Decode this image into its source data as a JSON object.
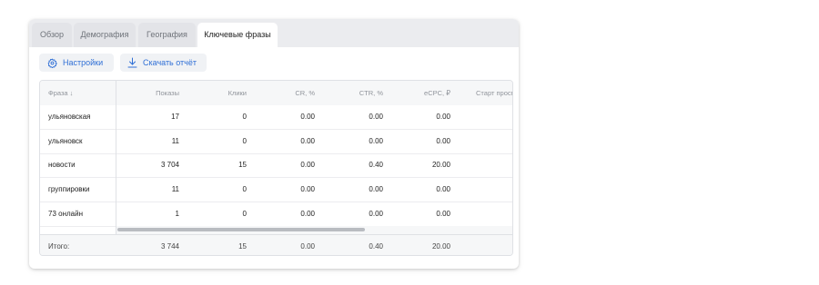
{
  "tabs": [
    {
      "label": "Обзор",
      "active": false
    },
    {
      "label": "Демография",
      "active": false
    },
    {
      "label": "География",
      "active": false
    },
    {
      "label": "Ключевые фразы",
      "active": true
    }
  ],
  "toolbar": {
    "settings_label": "Настройки",
    "settings_icon": "gear-icon",
    "report_label": "Скачать отчёт",
    "report_icon": "download-icon",
    "accent_color": "#2f6fd6"
  },
  "table": {
    "columns": [
      "Фраза ↓",
      "Показы",
      "Клики",
      "CR, %",
      "CTR, %",
      "eCPC, ₽",
      "Старт просм"
    ],
    "rows": [
      [
        "ульяновская",
        "17",
        "0",
        "0.00",
        "0.00",
        "0.00",
        ""
      ],
      [
        "ульяновск",
        "11",
        "0",
        "0.00",
        "0.00",
        "0.00",
        ""
      ],
      [
        "новости",
        "3 704",
        "15",
        "0.00",
        "0.40",
        "20.00",
        ""
      ],
      [
        "группировки",
        "11",
        "0",
        "0.00",
        "0.00",
        "0.00",
        ""
      ],
      [
        "73 онлайн",
        "1",
        "0",
        "0.00",
        "0.00",
        "0.00",
        ""
      ]
    ],
    "footer": [
      "Итого:",
      "3 744",
      "15",
      "0.00",
      "0.40",
      "20.00",
      ""
    ]
  }
}
